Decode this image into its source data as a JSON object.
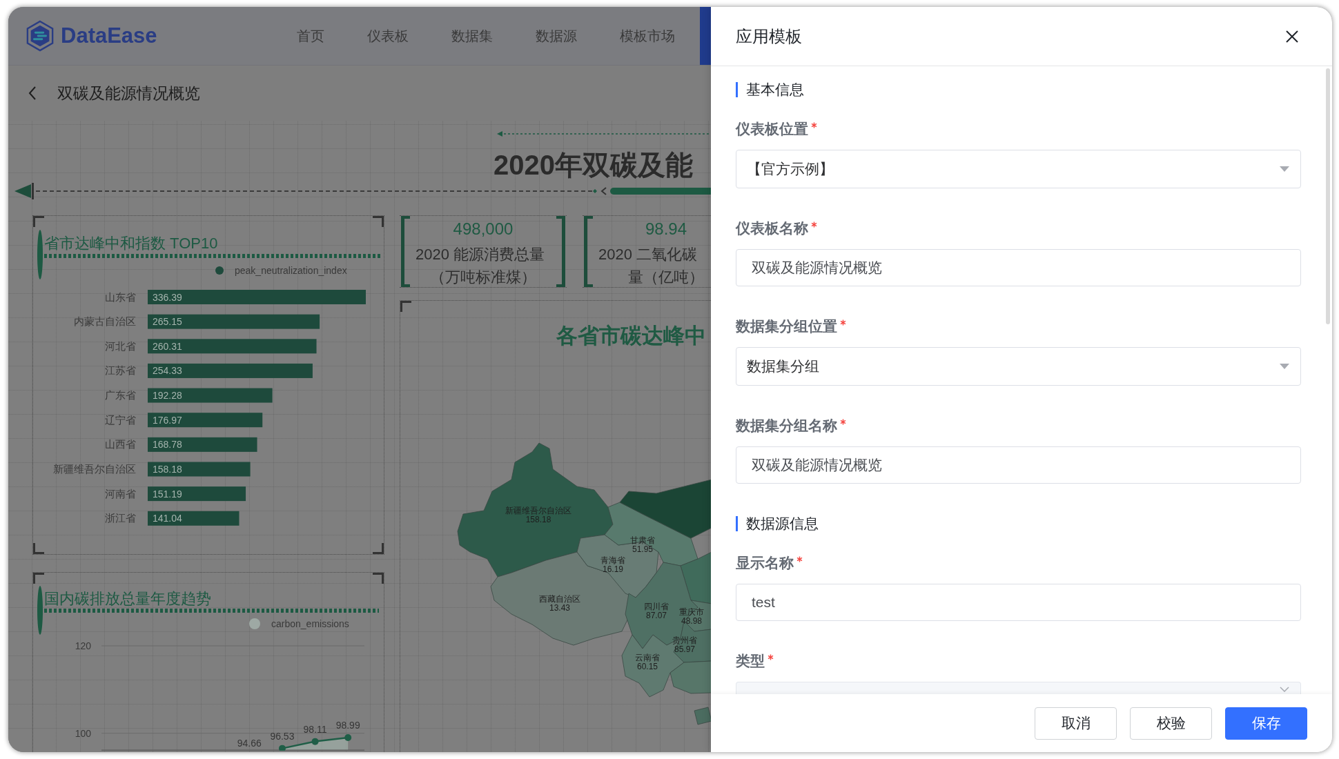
{
  "topbar": {
    "logo": "DataEase",
    "nav": [
      {
        "label": "首页",
        "selected": false
      },
      {
        "label": "仪表板",
        "selected": false
      },
      {
        "label": "数据集",
        "selected": false
      },
      {
        "label": "数据源",
        "selected": false
      },
      {
        "label": "模板市场",
        "selected": false
      }
    ]
  },
  "breadcrumb": {
    "title": "双碳及能源情况概览"
  },
  "dashboard": {
    "title": "2020年双碳及能",
    "kpis": [
      {
        "value": "498,000",
        "label_lines": [
          "2020 能源消费总量",
          "（万吨标准煤）"
        ]
      },
      {
        "value": "98.94",
        "label_lines": [
          "2020 二氧化碳",
          "量（亿吨）"
        ]
      }
    ],
    "ranking": {
      "title": "省市达峰中和指数 TOP10",
      "chart_data": {
        "type": "bar",
        "orientation": "horizontal",
        "categories": [
          "山东省",
          "内蒙古自治区",
          "河北省",
          "江苏省",
          "广东省",
          "辽宁省",
          "山西省",
          "新疆维吾尔自治区",
          "河南省",
          "浙江省"
        ],
        "series": [
          {
            "name": "peak_neutralization_index",
            "color": "#1e4a3c",
            "values": [
              336.39,
              265.15,
              260.31,
              254.33,
              192.28,
              176.97,
              168.78,
              158.18,
              151.19,
              141.04
            ]
          }
        ],
        "data_labels": true
      }
    },
    "trend": {
      "title": "国内碳排放总量年度趋势",
      "chart_data": {
        "type": "area",
        "series": [
          {
            "name": "carbon_emissions",
            "color": "#1f5e47",
            "values": [
              null,
              null,
              null,
              null,
              null,
              96.53,
              98.11,
              98.99
            ]
          }
        ],
        "ylim": [
          96,
          120
        ],
        "yticks": [
          100,
          120
        ],
        "data_labels": true,
        "annotations": [
          "94.66"
        ]
      }
    },
    "map": {
      "title": "各省市碳达峰中",
      "regions": [
        {
          "name": "新疆维吾尔自治区",
          "value": "158.18",
          "color": "#2d5a4a"
        },
        {
          "name": "西藏自治区",
          "value": "13.43",
          "color": "#6b7a74"
        },
        {
          "name": "青海省",
          "value": "16.19",
          "color": "#687c75"
        },
        {
          "name": "甘肃省",
          "value": "51.95",
          "color": "#587a6d"
        },
        {
          "color": "#1b4535"
        },
        {
          "color": "#406b5b"
        },
        {
          "name": "四川省",
          "value": "87.07",
          "color": "#4f7064"
        },
        {
          "name": "重庆市",
          "value": "48.98",
          "color": "#567569"
        },
        {
          "name": "贵州省",
          "value": "85.97",
          "color": "#4e6f63"
        },
        {
          "name": "云南省",
          "value": "60.15",
          "color": "#5f7a70"
        },
        {
          "color": "#577669"
        },
        {
          "color": "#4b6c60"
        }
      ]
    }
  },
  "drawer": {
    "title": "应用模板",
    "sections": [
      {
        "title": "基本信息",
        "fields": [
          {
            "kind": "select",
            "label": "仪表板位置",
            "required": true,
            "value": "【官方示例】",
            "disabled": false
          },
          {
            "kind": "input",
            "label": "仪表板名称",
            "required": true,
            "value": "双碳及能源情况概览",
            "disabled": false
          },
          {
            "kind": "select",
            "label": "数据集分组位置",
            "required": true,
            "value": "数据集分组",
            "disabled": false
          },
          {
            "kind": "input",
            "label": "数据集分组名称",
            "required": true,
            "value": "双碳及能源情况概览",
            "disabled": false
          }
        ]
      },
      {
        "title": "数据源信息",
        "fields": [
          {
            "kind": "input",
            "label": "显示名称",
            "required": true,
            "value": "test",
            "disabled": false
          },
          {
            "kind": "select",
            "label": "类型",
            "required": true,
            "disabled": true
          }
        ]
      }
    ],
    "buttons": [
      {
        "label": "取消",
        "kind": "default"
      },
      {
        "label": "校验",
        "kind": "default"
      },
      {
        "label": "保存",
        "kind": "primary"
      }
    ]
  }
}
